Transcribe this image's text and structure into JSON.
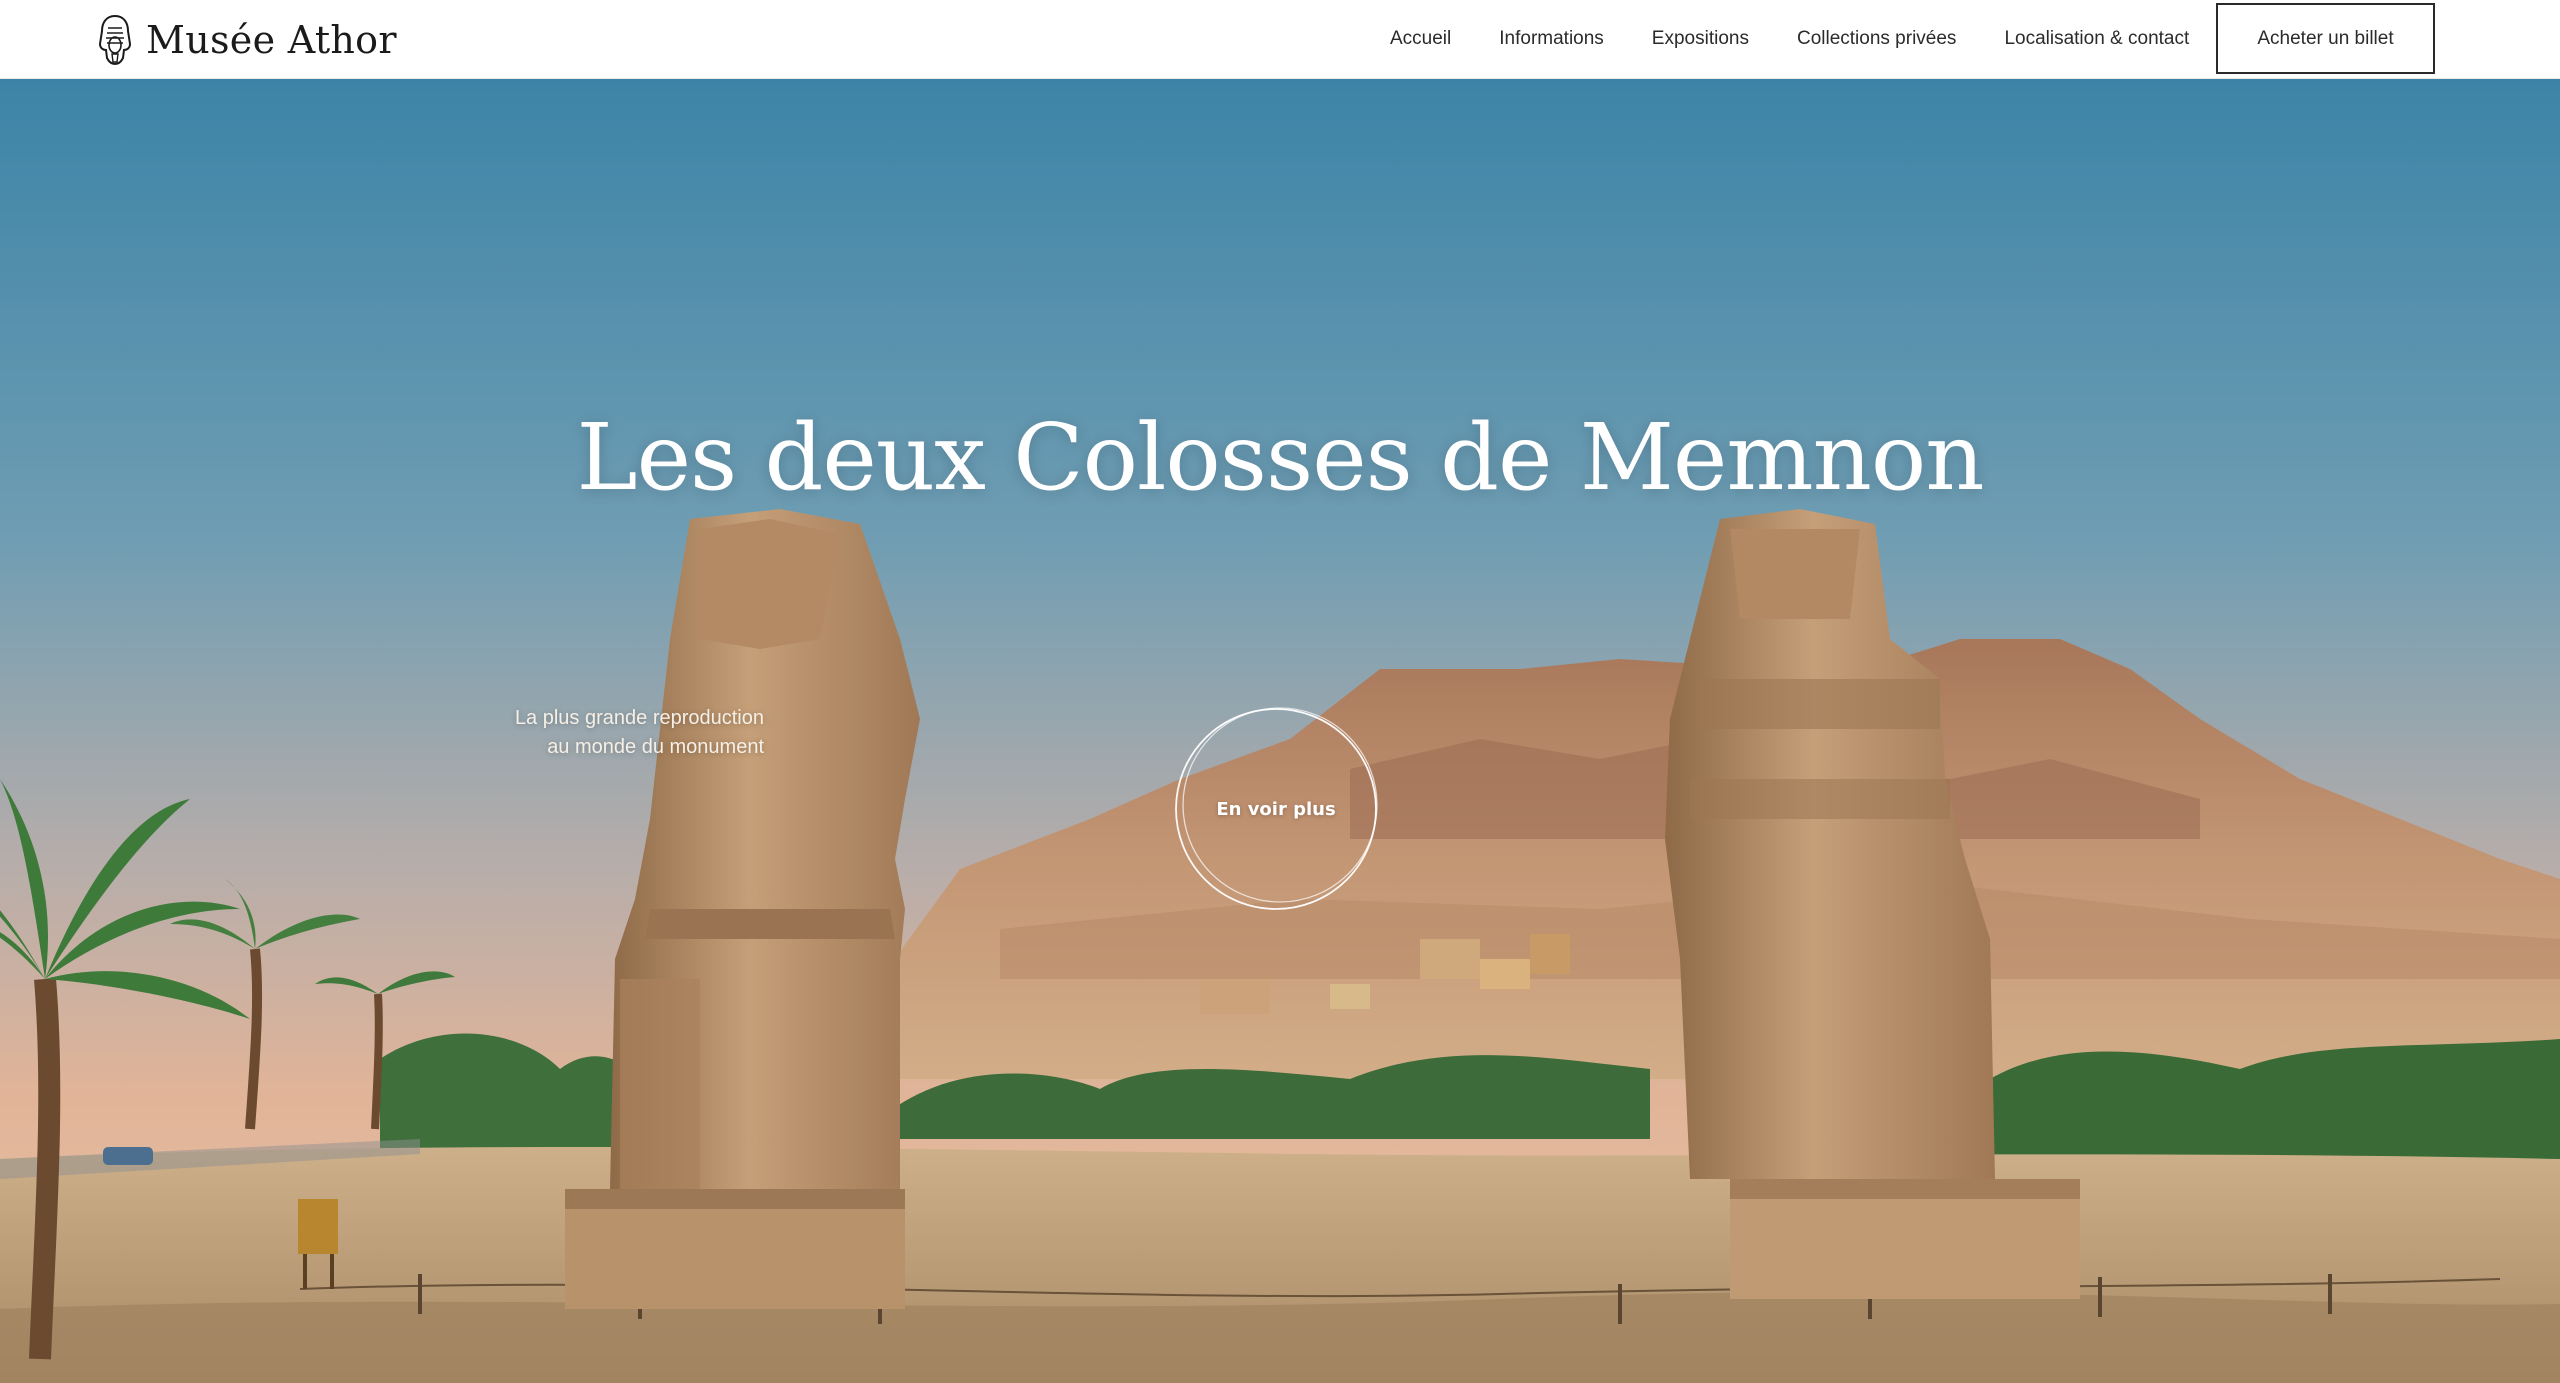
{
  "header": {
    "logo_text": "Musée Athor",
    "nav": [
      {
        "label": "Accueil"
      },
      {
        "label": "Informations"
      },
      {
        "label": "Expositions"
      },
      {
        "label": "Collections privées"
      },
      {
        "label": "Localisation & contact"
      }
    ],
    "buy_label": "Acheter un billet"
  },
  "hero": {
    "title": "Les deux Colosses de Memnon",
    "subtitle_lines": [
      "La plus grande reproduction",
      "au monde du monument"
    ],
    "cta_label": "En voir plus"
  },
  "icons": {
    "logo": "pharaoh-head-icon"
  },
  "colors": {
    "header_bg": "#ffffff",
    "text_dark": "#2b2b2b",
    "hero_text": "#ffffff",
    "sky_top": "#3f86a8",
    "sky_horizon": "#e3b99a",
    "sand": "#c9a97e"
  }
}
